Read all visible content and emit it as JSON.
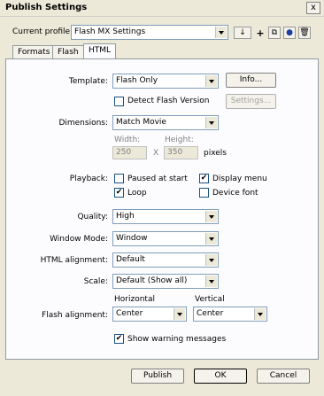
{
  "window": {
    "title": "Publish Settings",
    "close_symbol": "x"
  },
  "profile": {
    "label": "Current profile:",
    "value": "Flash MX Settings"
  },
  "tabs": [
    "Formats",
    "Flash",
    "HTML"
  ],
  "html_tab": {
    "template": {
      "label": "Template:",
      "value": "Flash Only",
      "info_button": "Info..."
    },
    "detect_flash": {
      "label": "Detect Flash Version",
      "checked": false,
      "settings_button": "Settings..."
    },
    "dimensions": {
      "label": "Dimensions:",
      "value": "Match Movie",
      "width_label": "Width:",
      "height_label": "Height:",
      "width_value": "250",
      "height_value": "350",
      "x_symbol": "X",
      "units": "pixels"
    },
    "playback": {
      "label": "Playback:",
      "paused": {
        "label": "Paused at start",
        "checked": false
      },
      "display_menu": {
        "label": "Display menu",
        "checked": true
      },
      "loop": {
        "label": "Loop",
        "checked": true
      },
      "device_font": {
        "label": "Device font",
        "checked": false
      }
    },
    "quality": {
      "label": "Quality:",
      "value": "High"
    },
    "window_mode": {
      "label": "Window Mode:",
      "value": "Window"
    },
    "html_alignment": {
      "label": "HTML alignment:",
      "value": "Default"
    },
    "scale": {
      "label": "Scale:",
      "value": "Default (Show all)"
    },
    "flash_alignment": {
      "label": "Flash alignment:",
      "horizontal_label": "Horizontal",
      "horizontal_value": "Center",
      "vertical_label": "Vertical",
      "vertical_value": "Center"
    },
    "show_warnings": {
      "label": "Show warning messages",
      "checked": true
    }
  },
  "buttons": {
    "publish": "Publish",
    "ok": "OK",
    "cancel": "Cancel"
  },
  "check_symbol": "✔",
  "profile_icons": {
    "import_export": "↓",
    "add": "+",
    "duplicate": "⧉",
    "info": "●",
    "delete": "🗑"
  }
}
